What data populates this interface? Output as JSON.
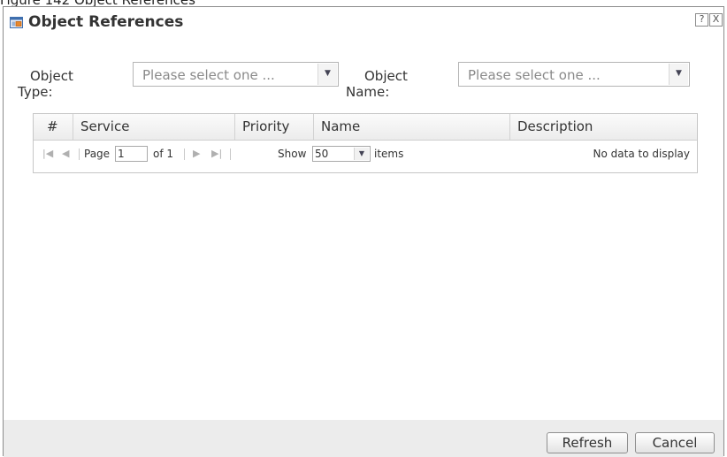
{
  "caption_partial": "Figure 142  Object References",
  "dialog": {
    "title": "Object References",
    "help_label": "?",
    "close_label": "X"
  },
  "filters": {
    "object_type_label_line1": "Object",
    "object_type_label_line2": "Type:",
    "object_type_value": "Please select one ...",
    "object_name_label_line1": "Object",
    "object_name_label_line2": "Name:",
    "object_name_value": "Please select one ..."
  },
  "table": {
    "columns": [
      "#",
      "Service",
      "Priority",
      "Name",
      "Description"
    ],
    "rows": []
  },
  "pager": {
    "first_icon": "|◀",
    "prev_icon": "◀",
    "page_label": "Page",
    "page_value": "1",
    "of_label": "of 1",
    "next_icon": "▶",
    "last_icon": "▶|",
    "show_label": "Show",
    "show_value": "50",
    "items_label": "items",
    "empty_message": "No data to display"
  },
  "buttons": {
    "refresh": "Refresh",
    "cancel": "Cancel"
  },
  "colors": {
    "footer_bg": "#ececec",
    "header_bg": "#f0f0f0",
    "border": "#8c8c8c"
  },
  "icons": [
    "dialog-window-icon",
    "help-icon",
    "close-icon",
    "dropdown-arrow-icon",
    "first-page-icon",
    "prev-page-icon",
    "next-page-icon",
    "last-page-icon"
  ]
}
